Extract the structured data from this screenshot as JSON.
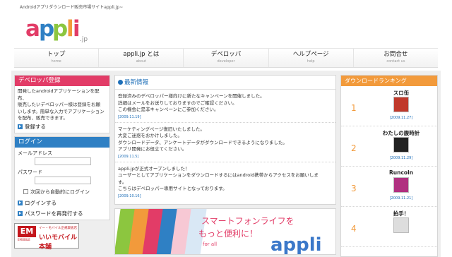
{
  "header": {
    "tagline": "Androidアプリダウンロード販売市場サイトappli.jp~",
    "logo": {
      "letters": [
        "a",
        "p",
        "p",
        "l",
        "i"
      ],
      "suffix": ".jp",
      "colors": [
        "#e23c67",
        "#2f80c4",
        "#8cc63f",
        "#f29a3b",
        "#e23c67"
      ]
    }
  },
  "nav": [
    {
      "label": "トップ",
      "sub": "home"
    },
    {
      "label": "appli.jp とは",
      "sub": "about"
    },
    {
      "label": "デベロッパ",
      "sub": "developer"
    },
    {
      "label": "ヘルプページ",
      "sub": "help"
    },
    {
      "label": "お問合せ",
      "sub": "contact us"
    }
  ],
  "developer_panel": {
    "title": "デベロッパ登録",
    "lines": [
      "開発したandroidアプリケーションを配布、",
      "販売したいデベロッパー様は登録をお願",
      "いします。簡単な入力でアプリケーション",
      "を配布、販売できます。"
    ],
    "link": "登録する"
  },
  "login_panel": {
    "title": "ログイン",
    "email_label": "メールアドレス",
    "password_label": "パスワード",
    "auto_login": "次回から自動的にログイン",
    "login_link": "ログインする",
    "reset_link": "パスワードを再発行する"
  },
  "banner": {
    "logo": "EM",
    "logo_sub": "EMOBILE",
    "small": "イー・モバイル正規取扱店",
    "big": "いいモバイル本舗"
  },
  "news": {
    "title": "最新情報",
    "items": [
      {
        "lines": [
          "登録済みのデベロッパー様向けに新たなキャンペーンを開催しました。",
          "詳細はメールをお送りしておりますのでご確認ください。",
          "この機会に是非キャンペーンにご参加ください。"
        ],
        "date": "[2009.11.19]"
      },
      {
        "lines": [
          "マーケティングページ復旧いたしました。",
          "大変ご迷惑をおかけしました。",
          "ダウンロードデータ、アンケートデータがダウンロードできるようになりました。",
          "アプリ開発にお役立てください。"
        ],
        "date": "[2009.11.5]"
      },
      {
        "lines": [
          "appli.jpが正式オープンしました！",
          "ユーザーとしてアプリケーションをダウンロードするにはandroid携帯からアクセスをお願いしま",
          "す。",
          "こちらはデベロッパー専用サイトとなっております。"
        ],
        "date": "[2009.10.16]"
      }
    ]
  },
  "promo": {
    "line1": "スマートフォンライフを",
    "line2": "もっと便利に！",
    "for": "for all",
    "logo": "appli",
    "stripe_colors": [
      "#8cc63f",
      "#f29a3b",
      "#e23c67",
      "#2f80c4",
      "#f7c8d4",
      "#d9e8f5"
    ]
  },
  "ranking": {
    "title": "ダウンロードランキング",
    "items": [
      {
        "rank": "1",
        "name": "スロ缶",
        "date": "[2009.11.27]",
        "icon_color": "#c0392b"
      },
      {
        "rank": "2",
        "name": "わたしの腹時計",
        "date": "[2009.11.29]",
        "icon_color": "#222222"
      },
      {
        "rank": "3",
        "name": "Runcoln",
        "date": "[2009.11.21]",
        "icon_color": "#b03080"
      },
      {
        "rank": "4",
        "name": "拍手！",
        "date": "",
        "icon_color": "#dddddd"
      }
    ]
  }
}
